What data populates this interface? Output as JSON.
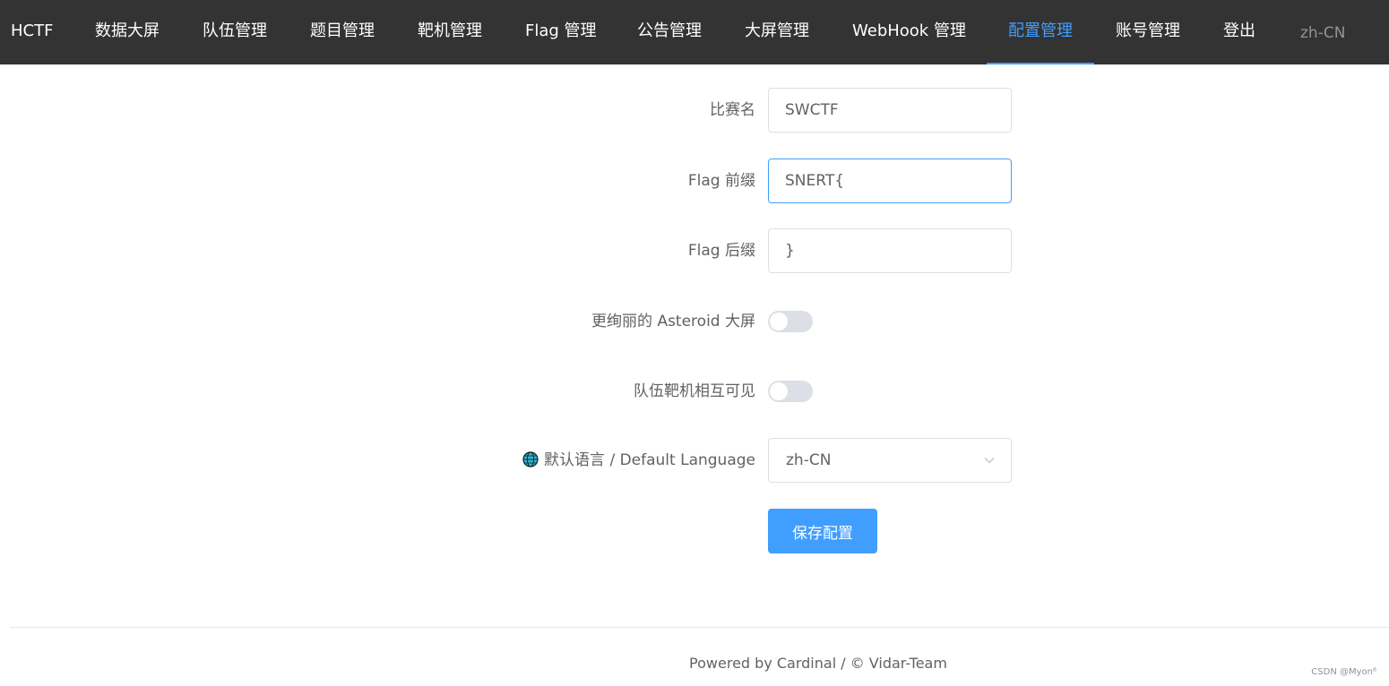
{
  "nav": {
    "brand": "HCTF",
    "items": [
      {
        "label": "数据大屏"
      },
      {
        "label": "队伍管理"
      },
      {
        "label": "题目管理"
      },
      {
        "label": "靶机管理"
      },
      {
        "label": "Flag 管理"
      },
      {
        "label": "公告管理"
      },
      {
        "label": "大屏管理"
      },
      {
        "label": "WebHook 管理"
      },
      {
        "label": "配置管理",
        "active": true
      },
      {
        "label": "账号管理"
      },
      {
        "label": "登出"
      }
    ],
    "language": "zh-CN",
    "active_color": "#409eff",
    "background_color": "#333333"
  },
  "form": {
    "title_label": "比赛名",
    "title_value": "SWCTF",
    "flag_prefix_label": "Flag 前缀",
    "flag_prefix_value": "SNERT{",
    "flag_suffix_label": "Flag 后缀",
    "flag_suffix_value": "}",
    "asteroid_label": "更绚丽的 Asteroid 大屏",
    "asteroid_enabled": false,
    "visible_label": "队伍靶机相互可见",
    "visible_enabled": false,
    "language_icon": "globe-icon",
    "language_label": "默认语言 / Default Language",
    "language_value": "zh-CN",
    "save_label": "保存配置"
  },
  "footer": {
    "text": "Powered by Cardinal / © Vidar-Team",
    "watermark": "CSDN @Myon⁶"
  }
}
